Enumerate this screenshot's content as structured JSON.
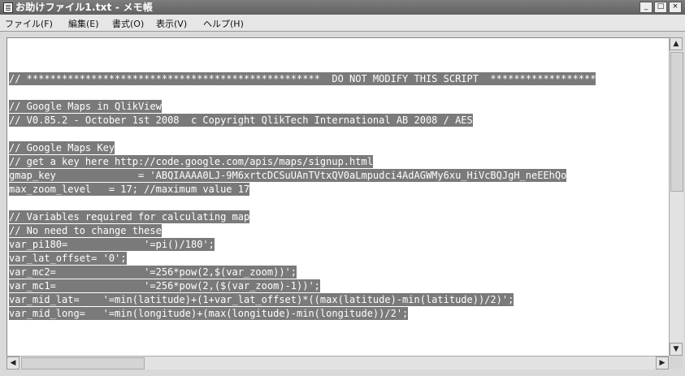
{
  "window": {
    "title": "お助けファイル1.txt - メモ帳",
    "minimize_label": "_",
    "maximize_label": "□",
    "close_label": "×"
  },
  "menu": [
    "ファイル(F)",
    "編集(E)",
    "書式(O)",
    "表示(V)",
    "ヘルプ(H)"
  ],
  "editor_lines": [
    {
      "text": "",
      "selected": false
    },
    {
      "text": "",
      "selected": false
    },
    {
      "text": "// **************************************************  DO NOT MODIFY THIS SCRIPT  ******************",
      "selected": true
    },
    {
      "text": "",
      "selected": false
    },
    {
      "text": "// Google Maps in QlikView",
      "selected": true
    },
    {
      "text": "// V0.85.2 - October 1st 2008  c Copyright QlikTech International AB 2008 / AES",
      "selected": true
    },
    {
      "text": "",
      "selected": false
    },
    {
      "text": "// Google Maps Key",
      "selected": true
    },
    {
      "text": "// get a key here http://code.google.com/apis/maps/signup.html",
      "selected": true
    },
    {
      "text": "gmap_key              = 'ABQIAAAA0LJ-9M6xrtcDCSuUAnTVtxQV0aLmpudci4AdAGWMy6xu_HiVcBQJgH_neEEhQo",
      "selected": true
    },
    {
      "text": "max_zoom_level   = 17; //maximum value 17",
      "selected": true
    },
    {
      "text": "",
      "selected": false
    },
    {
      "text": "// Variables required for calculating map",
      "selected": true
    },
    {
      "text": "// No need to change these",
      "selected": true
    },
    {
      "text": "var_pi180=             '=pi()/180';",
      "selected": true
    },
    {
      "text": "var_lat_offset= '0';",
      "selected": true
    },
    {
      "text": "var_mc2=               '=256*pow(2,$(var_zoom))';",
      "selected": true
    },
    {
      "text": "var_mc1=               '=256*pow(2,($(var_zoom)-1))';",
      "selected": true
    },
    {
      "text": "var_mid_lat=    '=min(latitude)+(1+var_lat_offset)*((max(latitude)-min(latitude))/2)';",
      "selected": true
    },
    {
      "text": "var_mid_long=   '=min(longitude)+(max(longitude)-min(longitude))/2';",
      "selected": true
    }
  ],
  "scrollbar": {
    "up_arrow": "▲",
    "down_arrow": "▼",
    "left_arrow": "◀",
    "right_arrow": "▶"
  }
}
